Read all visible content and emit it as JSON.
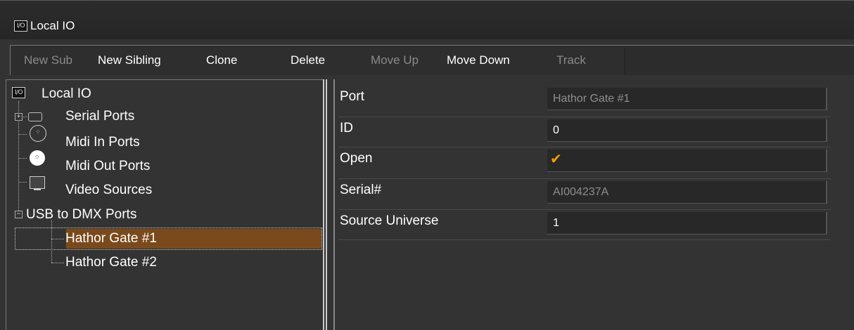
{
  "window": {
    "title": "Local IO",
    "icon": "io-icon"
  },
  "toolbar": {
    "new_sub": "New Sub",
    "new_sibling": "New Sibling",
    "clone": "Clone",
    "delete": "Delete",
    "move_up": "Move Up",
    "move_down": "Move Down",
    "track": "Track"
  },
  "tree": {
    "root": "Local IO",
    "serial_ports": "Serial Ports",
    "midi_in": "Midi In Ports",
    "midi_out": "Midi Out Ports",
    "video_sources": "Video Sources",
    "usb_dmx": "USB to DMX Ports",
    "gate1": "Hathor Gate #1",
    "gate2": "Hathor Gate #2"
  },
  "properties": {
    "port": {
      "label": "Port",
      "value": "Hathor Gate #1"
    },
    "id": {
      "label": "ID",
      "value": "0"
    },
    "open": {
      "label": "Open",
      "value": "✔"
    },
    "serial": {
      "label": "Serial#",
      "value": "AI004237A"
    },
    "source_universe": {
      "label": "Source Universe",
      "value": "1"
    }
  },
  "colors": {
    "selection": "#7a4a1c",
    "check": "#f0a000"
  }
}
